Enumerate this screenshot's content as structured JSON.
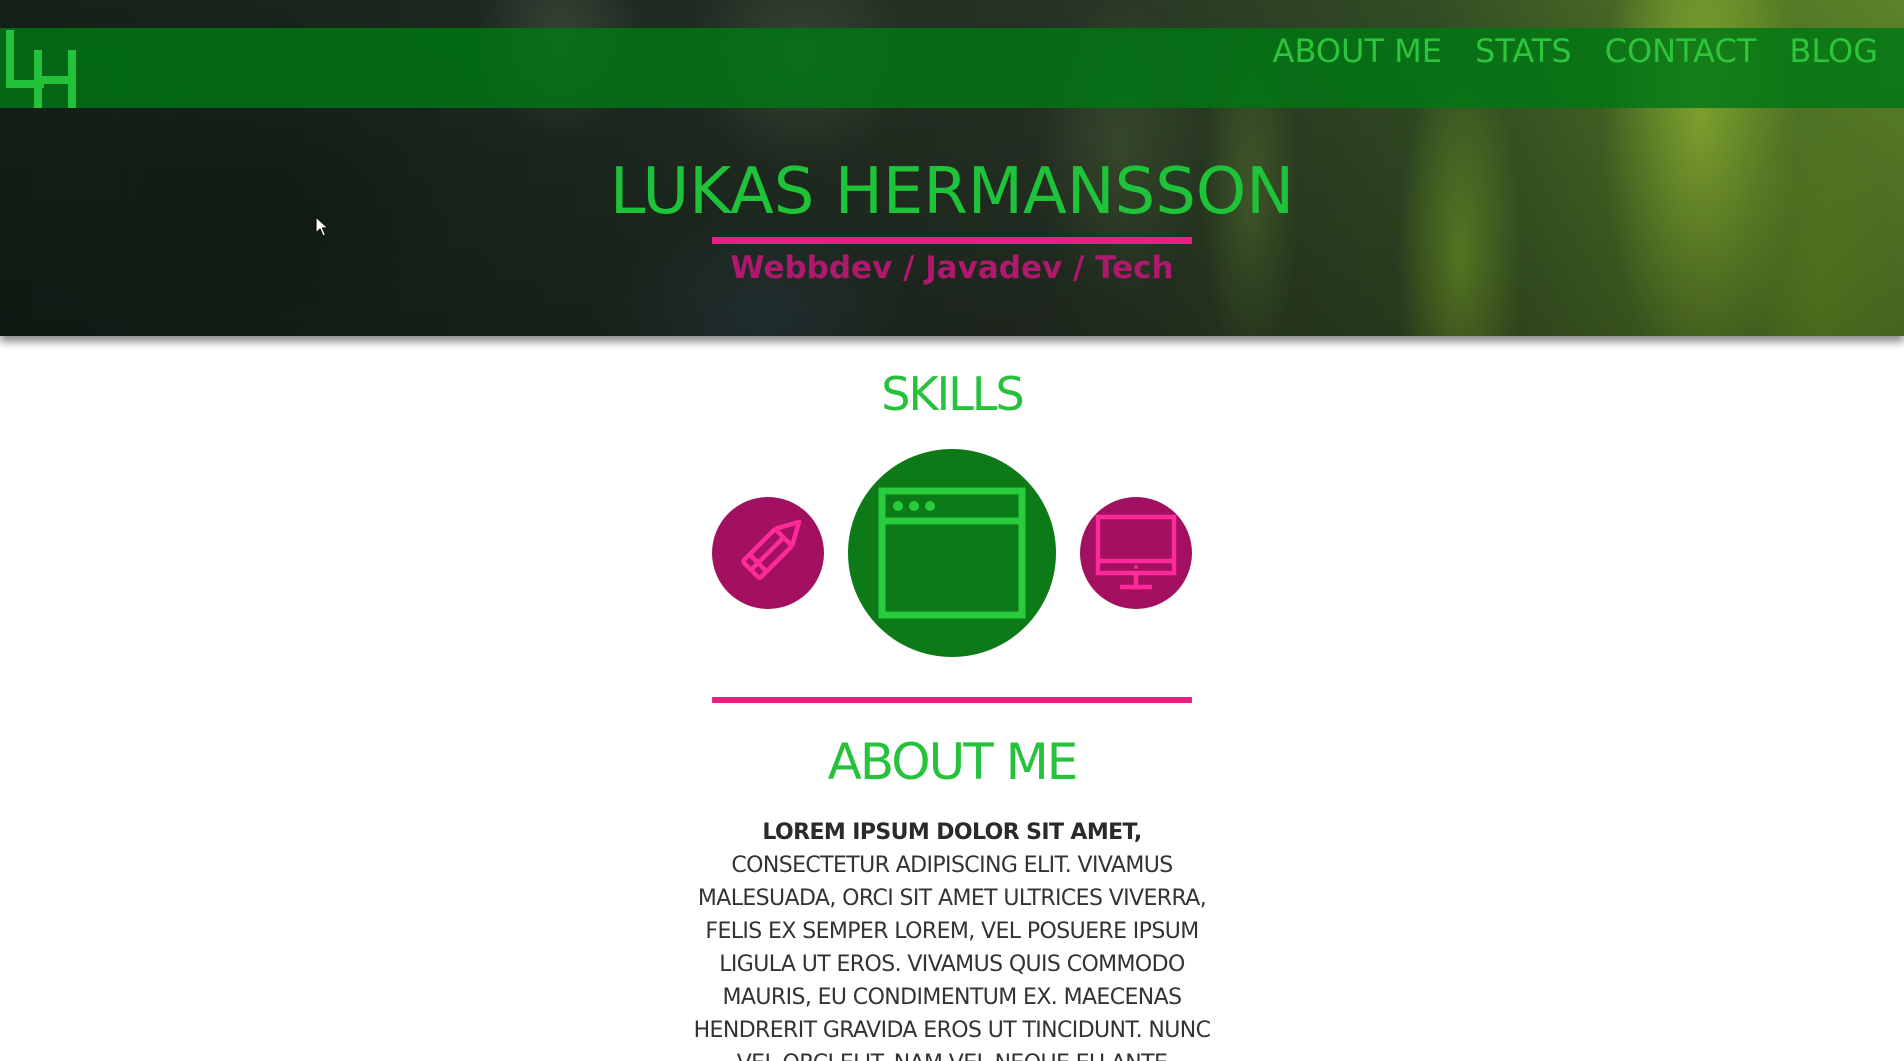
{
  "header": {
    "logo_text": "LH",
    "nav": [
      {
        "label": "ABOUT ME"
      },
      {
        "label": "STATS"
      },
      {
        "label": "CONTACT"
      },
      {
        "label": "BLOG"
      }
    ]
  },
  "hero": {
    "title": "LUKAS HERMANSSON",
    "subtitle": "Webbdev / Javadev / Tech"
  },
  "skills": {
    "heading": "SKILLS",
    "items": [
      {
        "icon": "pencil-icon"
      },
      {
        "icon": "browser-window-icon"
      },
      {
        "icon": "monitor-icon"
      }
    ]
  },
  "about": {
    "heading": "ABOUT ME",
    "lead": "LOREM IPSUM DOLOR SIT AMET,",
    "body": " CONSECTETUR ADIPISCING ELIT. VIVAMUS MALESUADA, ORCI SIT AMET ULTRICES VIVERRA, FELIS EX SEMPER LOREM, VEL POSUERE IPSUM LIGULA UT EROS. VIVAMUS QUIS COMMODO MAURIS, EU CONDIMENTUM EX. MAECENAS HENDRERIT GRAVIDA EROS UT TINCIDUNT. NUNC VEL ORCI ELIT. NAM VEL NEQUE EU ANTE VENENATIS ACCUMSAN. DONEC AC"
  },
  "colors": {
    "green": "#27c23c",
    "dark_green": "#0b7a17",
    "magenta": "#a3105f",
    "pink_rule": "#ea1f86"
  }
}
